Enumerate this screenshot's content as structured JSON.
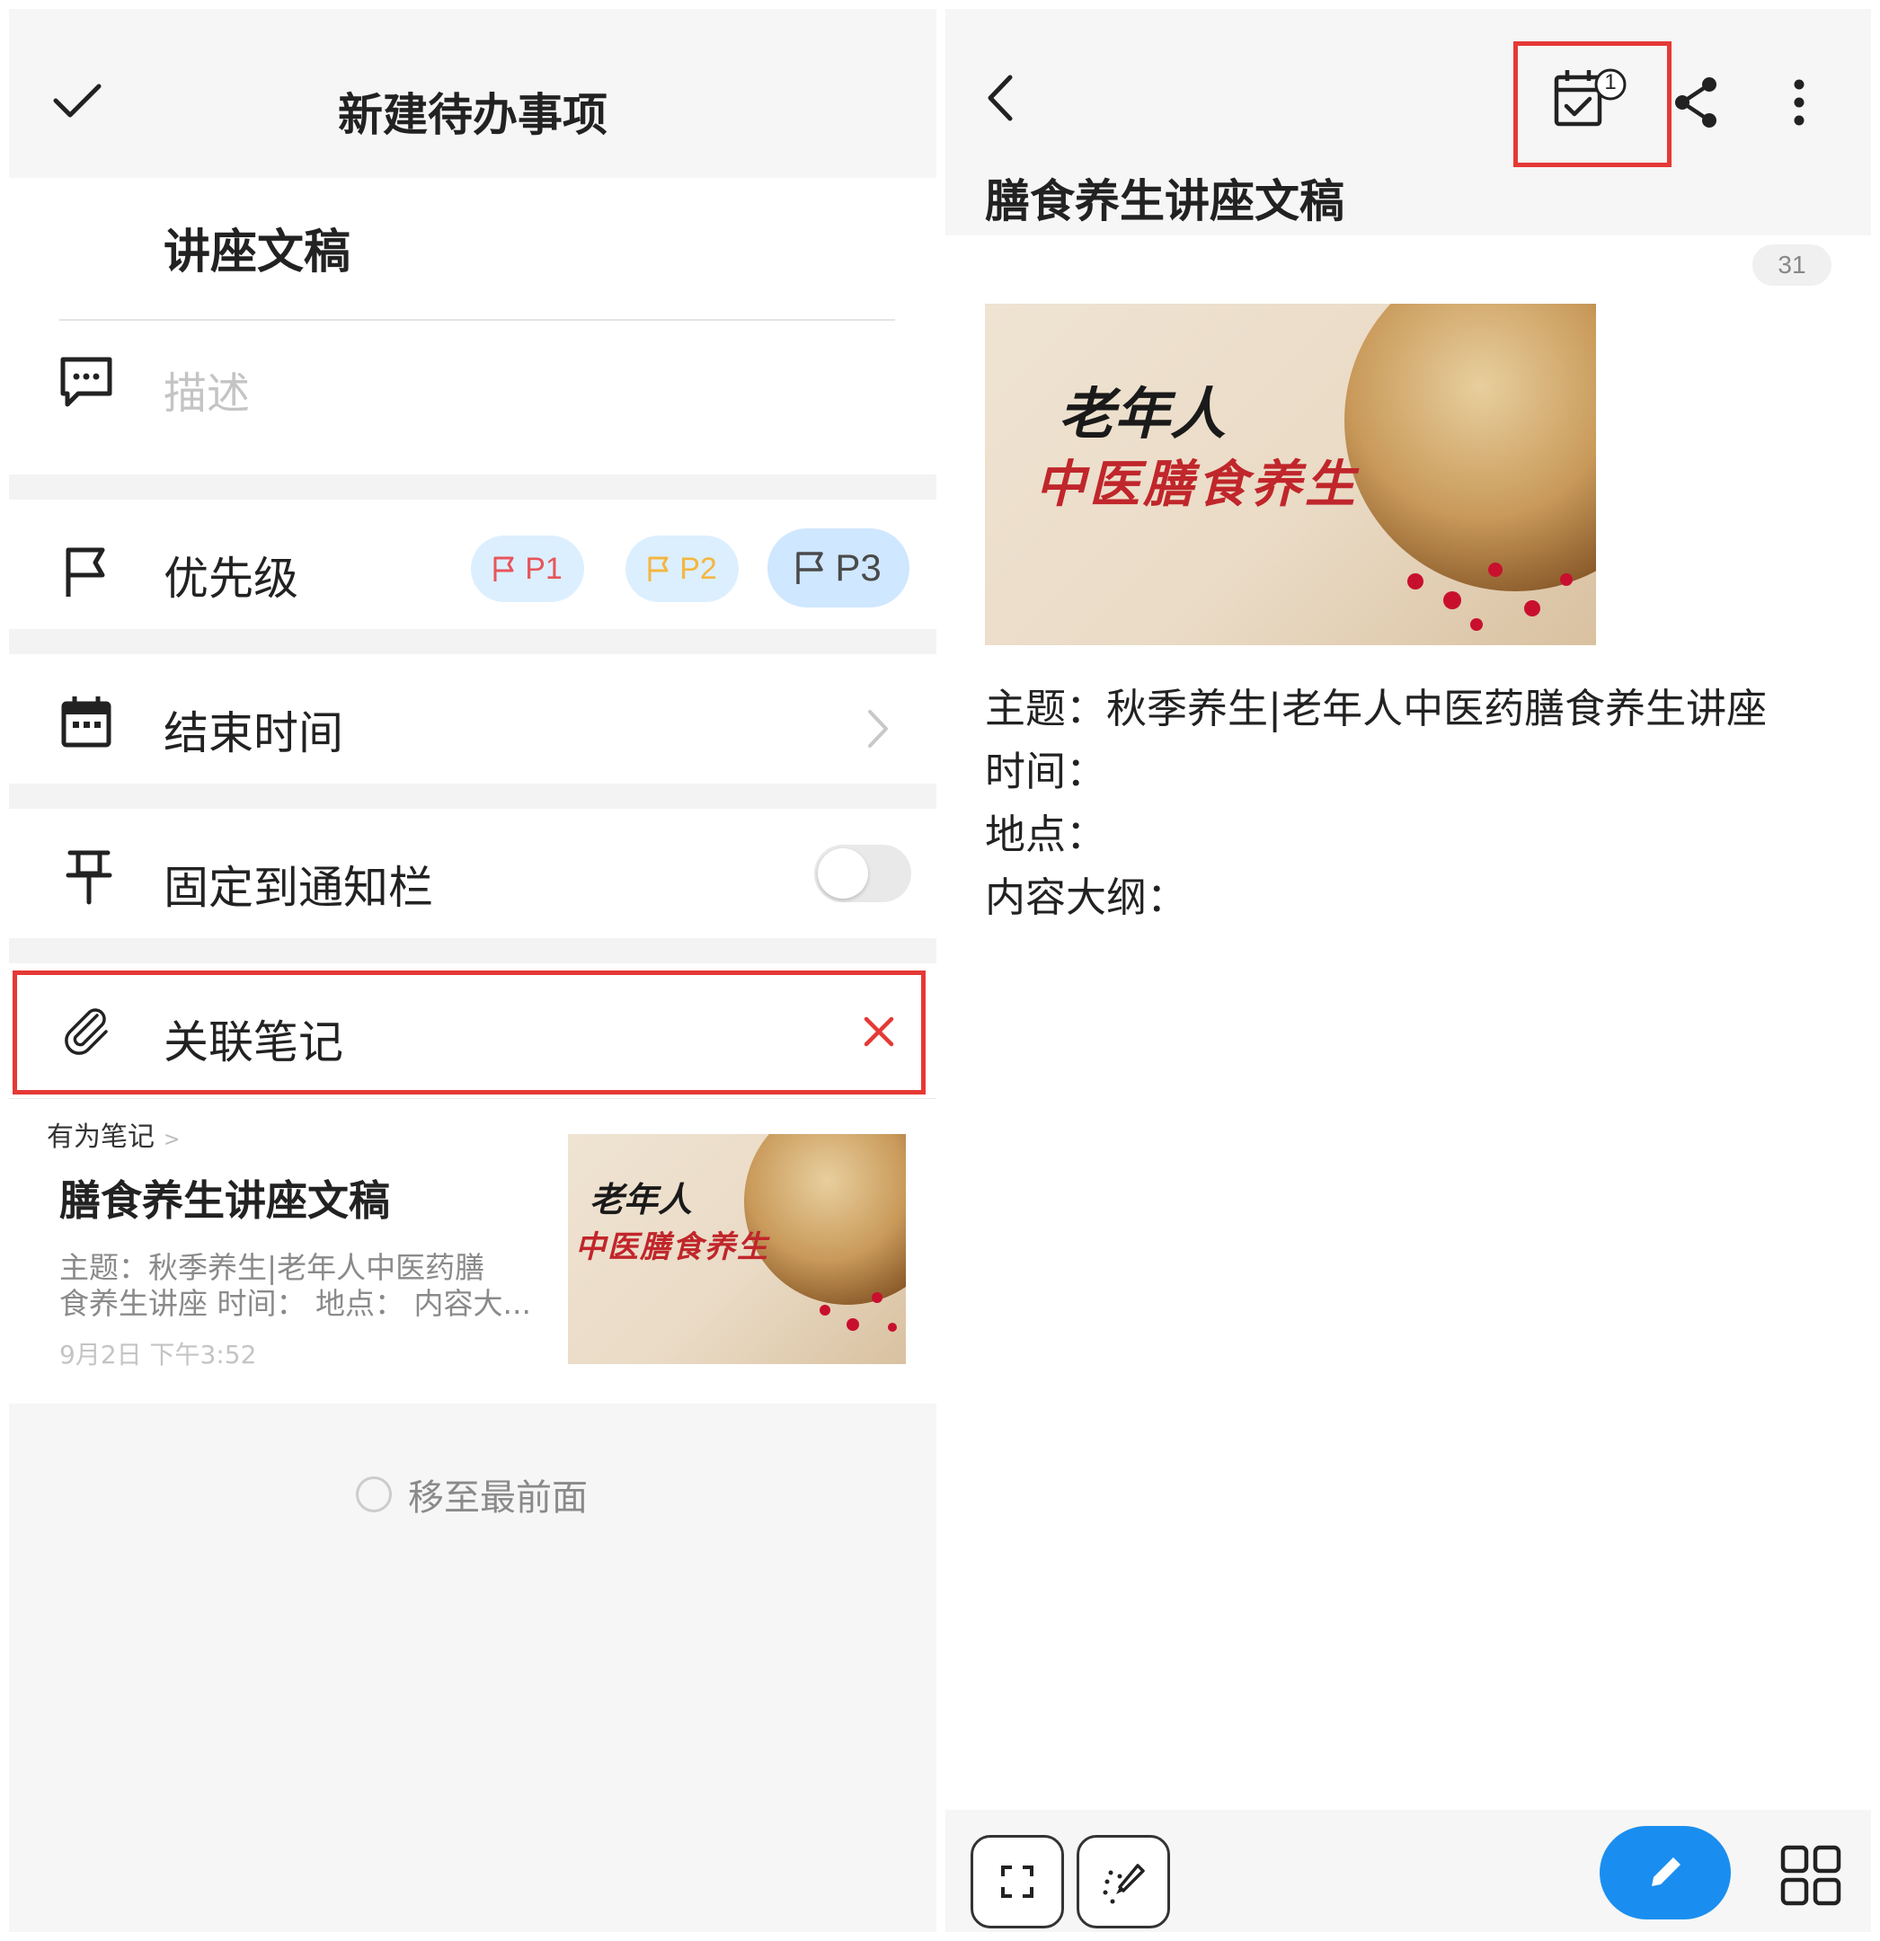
{
  "left": {
    "header_title": "新建待办事项",
    "task_title": "讲座文稿",
    "description_placeholder": "描述",
    "priority": {
      "label": "优先级",
      "options": [
        {
          "label": "P1",
          "color": "#e8555a"
        },
        {
          "label": "P2",
          "color": "#f4b63f"
        },
        {
          "label": "P3",
          "color": "#4a4a4a"
        }
      ],
      "selected": "P3"
    },
    "end_time_label": "结束时间",
    "pin_label": "固定到通知栏",
    "pin_enabled": false,
    "linked_note_label": "关联笔记",
    "note_card": {
      "source": "有为笔记",
      "title": "膳食养生讲座文稿",
      "snippet_line1": "主题：秋季养生|老年人中医药膳",
      "snippet_line2": "食养生讲座 时间：  地点：  内容大...",
      "date": "9月2日 下午3:52",
      "image_text1": "老年人",
      "image_text2": "中医膳食养生"
    },
    "move_to_front": "移至最前面"
  },
  "right": {
    "note_title": "膳食养生讲座文稿",
    "todo_badge": "1",
    "char_count": "31",
    "image_text1": "老年人",
    "image_text2": "中医膳食养生",
    "lines": [
      "主题：秋季养生|老年人中医药膳食养生讲座",
      "时间：",
      "地点：",
      "内容大纲："
    ]
  },
  "colors": {
    "accent_blue": "#1a8ef0",
    "highlight_red": "#e53935",
    "pill_bg": "#dcefff"
  },
  "icons": [
    "check-icon",
    "comment-icon",
    "flag-icon",
    "calendar-icon",
    "chevron-right-icon",
    "pin-icon",
    "paperclip-icon",
    "close-icon",
    "back-icon",
    "calendar-check-icon",
    "share-icon",
    "more-icon",
    "fullscreen-icon",
    "magic-brush-icon",
    "edit-icon",
    "grid-icon"
  ]
}
